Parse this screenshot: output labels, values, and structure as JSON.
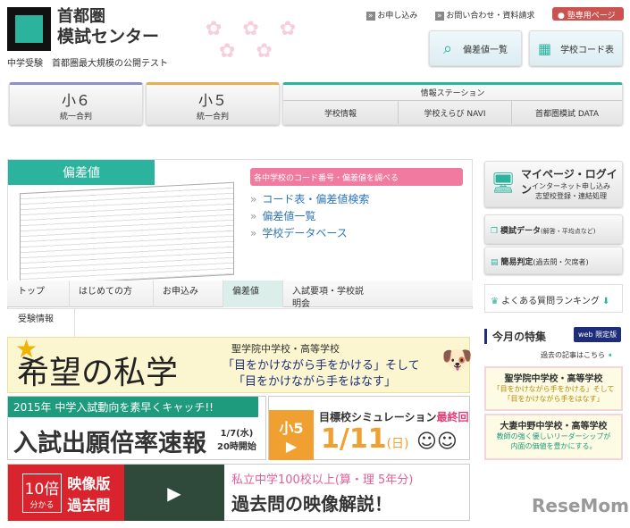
{
  "header": {
    "logo_line1": "首都圏",
    "logo_line2": "模試センター",
    "tagline": "中学受験　首都圏最大規模の公開テスト",
    "links": [
      "お申し込み",
      "お問い合わせ・資料請求"
    ],
    "juku_button": "塾専用ページ",
    "buttons": [
      "偏差値一覧",
      "学校コード表"
    ]
  },
  "nav": {
    "grade6": {
      "title": "小６",
      "sub": "統一合判"
    },
    "grade5": {
      "title": "小５",
      "sub": "統一合判"
    },
    "station": {
      "title": "情報ステーション",
      "items": [
        "学校情報",
        "学校えらび NAVI",
        "首都圏模試 DATA"
      ]
    }
  },
  "panel": {
    "title": "偏差値",
    "pink_bar": "各中学校のコード番号・偏差値を調べる",
    "links": [
      "コード表・偏差値検索",
      "偏差値一覧",
      "学校データベース"
    ],
    "tabs": [
      "トップ",
      "はじめての方",
      "お申込み",
      "偏差値",
      "入試要項・学校説明会",
      "受験情報"
    ]
  },
  "banner1": {
    "title": "希望の私学",
    "school": "聖学院中学校・高等学校",
    "line1": "「目をかけながら手をかける」そして",
    "line2": "「目をかけながら手をはなす」"
  },
  "banner2": {
    "header": "2015年 中学入試動向を素早くキャッチ!!",
    "title": "入試出願倍率速報",
    "date": "1/7(水)",
    "time": "20時開始"
  },
  "banner3": {
    "grade": "小5",
    "title": "目標校シミュレーション",
    "final": "最終回",
    "date": "1/11",
    "day": "(日)"
  },
  "banner4": {
    "badge_big": "10倍",
    "badge_small": "分かる",
    "label1": "映像版",
    "label2": "過去問",
    "line1": "私立中学100校以上(算・理 5年分)",
    "line2": "過去問の映像解説！"
  },
  "sidebar": {
    "mypage_title": "マイページ・ログイン",
    "mypage_sub1": "インターネット申し込み",
    "mypage_sub2": "志望校登録・連結処理",
    "data_title": "模試データ",
    "data_sub": "(解答・平均点など)",
    "judge_title": "簡易判定",
    "judge_sub": "(過去問・欠席者)",
    "faq": "よくある質問ランキング",
    "feature": "今月の特集",
    "web_badge": "web 限定版",
    "past": "過去の記事はこちら",
    "cards": [
      {
        "school": "聖学院中学校・高等学校",
        "l1": "「目をかけながら手をかける」そして",
        "l2": "「目をかけながら手をはなす」"
      },
      {
        "school": "大妻中野中学校・高等学校",
        "l1": "教師の強く優しいリーダーシップが",
        "l2": "内面の価値を豊かにする。"
      }
    ]
  },
  "watermark": "ReseMom"
}
